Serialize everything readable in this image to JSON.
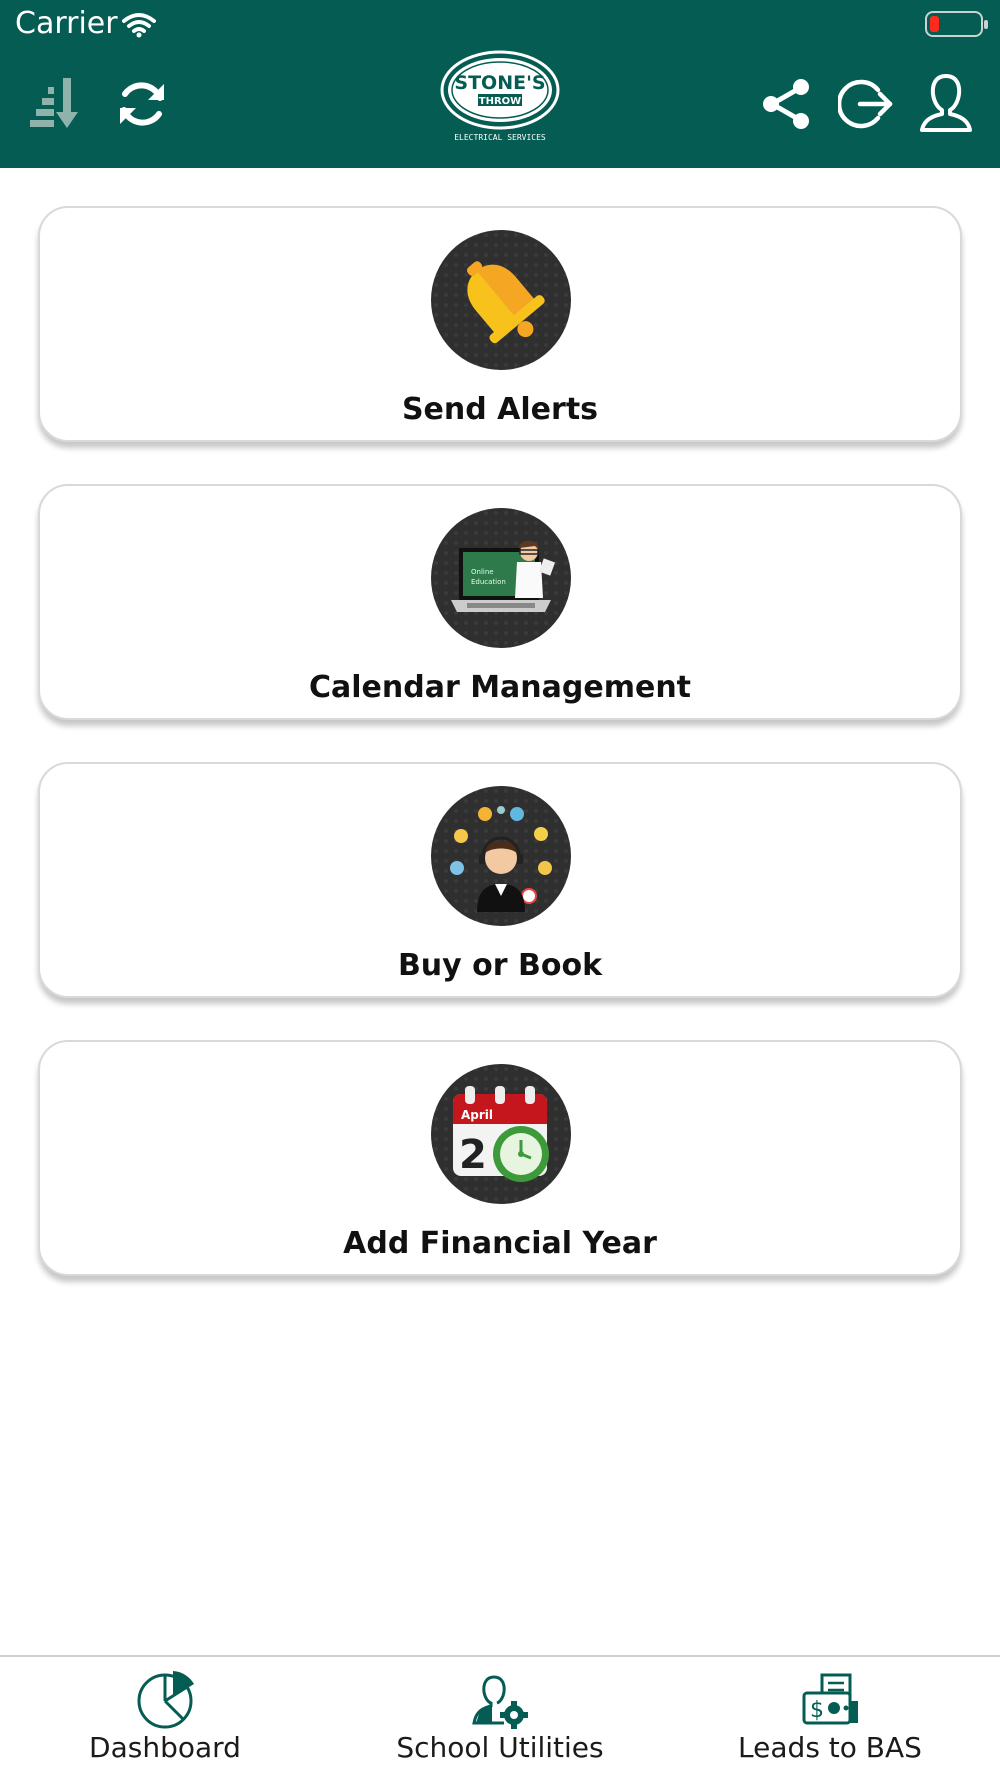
{
  "status_bar": {
    "carrier": "Carrier"
  },
  "header": {
    "logo_text": {
      "line1": "STONE'S",
      "line2": "THROW",
      "sub": "ELECTRICAL SERVICES"
    },
    "left_icons": [
      "sort-icon",
      "refresh-icon"
    ],
    "right_icons": [
      "share-icon",
      "logout-icon",
      "profile-icon"
    ],
    "colors": {
      "header_bg": "#045c53",
      "accent": "#045c53"
    }
  },
  "cards": [
    {
      "label": "Send Alerts",
      "icon": "bell-icon"
    },
    {
      "label": "Calendar Management",
      "icon": "online-education-icon"
    },
    {
      "label": "Buy or Book",
      "icon": "customer-service-icon"
    },
    {
      "label": "Add Financial Year",
      "icon": "calendar-clock-icon",
      "calendar_text": {
        "month": "April",
        "day": "2"
      }
    }
  ],
  "tabs": [
    {
      "label": "Dashboard",
      "icon": "pie-chart-icon"
    },
    {
      "label": "School Utilities",
      "icon": "user-settings-icon"
    },
    {
      "label": "Leads to BAS",
      "icon": "money-receipt-icon"
    }
  ]
}
